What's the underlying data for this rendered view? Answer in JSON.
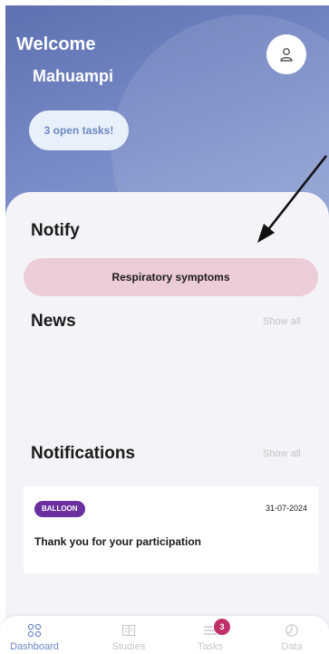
{
  "header": {
    "welcome": "Welcome",
    "username": "Mahuampi",
    "open_tasks": "3 open tasks!"
  },
  "notify": {
    "title": "Notify",
    "symptom_button": "Respiratory symptoms"
  },
  "news": {
    "title": "News",
    "show_all": "Show all"
  },
  "notifications": {
    "title": "Notifications",
    "show_all": "Show all",
    "items": [
      {
        "badge": "BALLOON",
        "date": "31-07-2024",
        "text": "Thank you for your participation"
      }
    ]
  },
  "bottom_nav": {
    "items": [
      {
        "label": "Dashboard",
        "icon": "grid-icon",
        "active": true
      },
      {
        "label": "Studies",
        "icon": "book-icon",
        "active": false
      },
      {
        "label": "Tasks",
        "icon": "tasks-icon",
        "active": false,
        "badge": "3"
      },
      {
        "label": "Data",
        "icon": "pie-chart-icon",
        "active": false
      }
    ]
  },
  "colors": {
    "header_start": "#5d70b1",
    "header_end": "#8ea0d3",
    "accent": "#6c87c7",
    "pill_pink": "#ecccd6",
    "badge_purple": "#6b2fa0",
    "task_badge": "#c12f68"
  }
}
